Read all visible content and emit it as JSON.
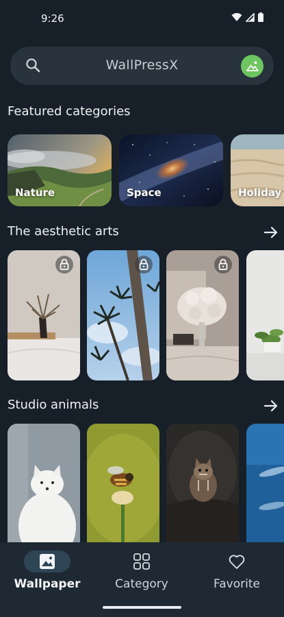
{
  "status": {
    "time": "9:26"
  },
  "search": {
    "title": "WallPressX"
  },
  "featured": {
    "title": "Featured categories",
    "items": [
      {
        "label": "Nature"
      },
      {
        "label": "Space"
      },
      {
        "label": "Holiday"
      }
    ]
  },
  "aesthetic": {
    "title": "The aesthetic arts"
  },
  "animals": {
    "title": "Studio animals"
  },
  "nav": {
    "items": [
      {
        "label": "Wallpaper",
        "icon": "image-icon",
        "active": true
      },
      {
        "label": "Category",
        "icon": "grid-icon",
        "active": false
      },
      {
        "label": "Favorite",
        "icon": "heart-icon",
        "active": false
      }
    ]
  },
  "colors": {
    "background": "#172029",
    "surface": "#29333d",
    "nav_bg": "#1e2933",
    "active_pill": "#2e4556",
    "accent_avatar": "#6cc55e"
  }
}
